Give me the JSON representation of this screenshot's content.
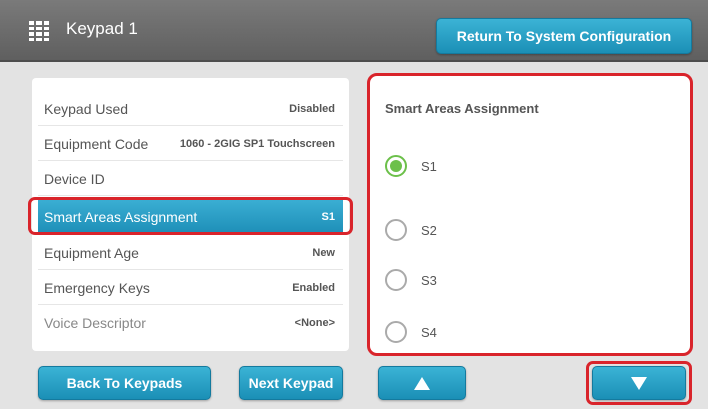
{
  "header": {
    "title": "Keypad 1",
    "icon": "keypad-grid-icon",
    "return_button": "Return To System Configuration"
  },
  "settings": [
    {
      "label": "Keypad Used",
      "value": "Disabled",
      "selected": false
    },
    {
      "label": "Equipment Code",
      "value": "1060 - 2GIG SP1 Touchscreen",
      "selected": false
    },
    {
      "label": "Device ID",
      "value": "",
      "selected": false
    },
    {
      "label": "Smart Areas Assignment",
      "value": "S1",
      "selected": true
    },
    {
      "label": "Equipment Age",
      "value": "New",
      "selected": false
    },
    {
      "label": "Emergency Keys",
      "value": "Enabled",
      "selected": false
    },
    {
      "label": "Voice Descriptor",
      "value": "<None>",
      "selected": false
    }
  ],
  "assignment_panel": {
    "title": "Smart Areas Assignment",
    "options": [
      {
        "label": "S1",
        "checked": true
      },
      {
        "label": "S2",
        "checked": false
      },
      {
        "label": "S3",
        "checked": false
      },
      {
        "label": "S4",
        "checked": false
      }
    ]
  },
  "footer": {
    "back_button": "Back To Keypads",
    "next_button": "Next Keypad",
    "scroll_up_icon": "arrow-up-icon",
    "scroll_down_icon": "arrow-down-icon"
  },
  "colors": {
    "accent": "#2aa2c9",
    "highlight": "#d9242b",
    "radio_checked": "#6cc04a"
  }
}
